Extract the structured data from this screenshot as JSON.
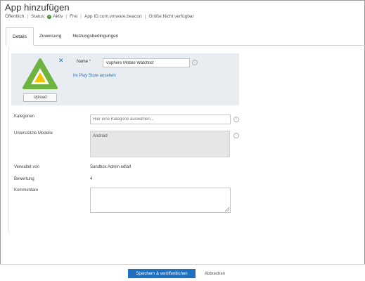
{
  "header": {
    "title": "App hinzufügen",
    "meta": {
      "visibility": "Öffentlich",
      "status_label": "Status:",
      "status_value": "Aktiv",
      "price": "Frei",
      "app_id": "App ID:com.vmware.beacon",
      "size": "Größe:Nicht verfügbar"
    }
  },
  "tabs": [
    {
      "label": "Details",
      "active": true
    },
    {
      "label": "Zuweisung",
      "active": false
    },
    {
      "label": "Nutzungsbedingungen",
      "active": false
    }
  ],
  "app_panel": {
    "upload_label": "Upload",
    "name_label": "Name",
    "required_marker": "*",
    "name_value": "vSphere Mobile Watchlist",
    "store_link": "Im Play Store ansehen",
    "icon_colors": {
      "outer": "#6db33f",
      "inner": "#f2c200"
    }
  },
  "form": {
    "categories_label": "Kategorien",
    "categories_placeholder": "Hier eine Kategorie auswählen...",
    "models_label": "Unterstützte Modelle",
    "models_value": "Android",
    "managed_by_label": "Verwaltet von",
    "managed_by_value": "Sandbox Admin edlatl",
    "rating_label": "Bewertung",
    "rating_value": "4",
    "comments_label": "Kommentare",
    "comments_value": ""
  },
  "footer": {
    "save_label": "Speichern & veröffentlichen",
    "cancel_label": "Abbrechen"
  },
  "colors": {
    "accent": "#1e70c1",
    "link": "#2f6fb8",
    "panel": "#e8edf2"
  }
}
